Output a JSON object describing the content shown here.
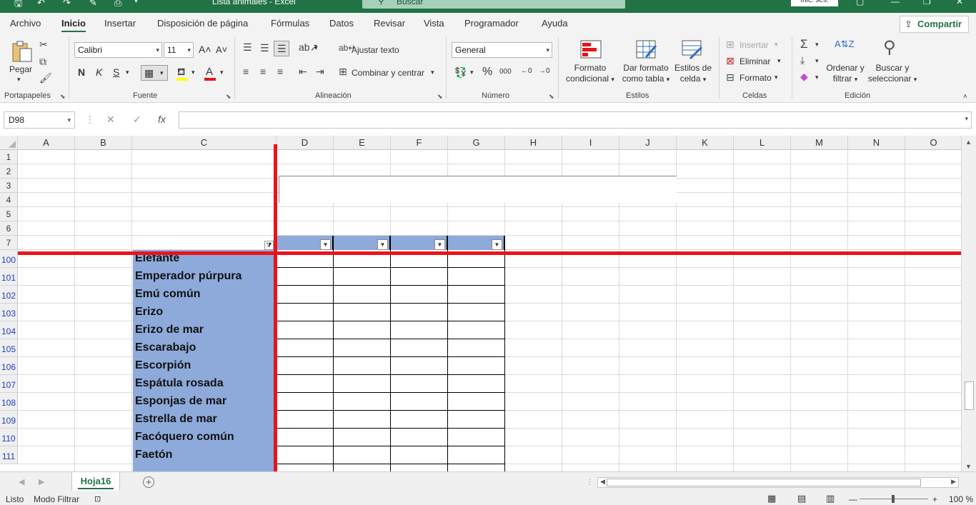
{
  "window": {
    "title": "Lista animales  -  Excel",
    "search_placeholder": "Buscar",
    "signin": "Inic. ses.",
    "share": "Compartir"
  },
  "menu": [
    "Archivo",
    "Inicio",
    "Insertar",
    "Disposición de página",
    "Fórmulas",
    "Datos",
    "Revisar",
    "Vista",
    "Programador",
    "Ayuda"
  ],
  "active_menu": "Inicio",
  "ribbon": {
    "groups": {
      "clipboard": "Portapapeles",
      "font": "Fuente",
      "alignment": "Alineación",
      "number": "Número",
      "styles": "Estilos",
      "cells": "Celdas",
      "editing": "Edición"
    },
    "paste": "Pegar",
    "font_name": "Calibri",
    "font_size": "11",
    "bold": "N",
    "italic": "K",
    "underline": "S",
    "wrap_text": "Ajustar texto",
    "merge_center": "Combinar y centrar",
    "number_format": "General",
    "conditional_format": [
      "Formato",
      "condicional"
    ],
    "format_table": [
      "Dar formato",
      "como tabla"
    ],
    "cell_styles": [
      "Estilos de",
      "celda"
    ],
    "insert": "Insertar",
    "delete": "Eliminar",
    "format": "Formato",
    "sort_filter": [
      "Ordenar y",
      "filtrar"
    ],
    "find_select": [
      "Buscar y",
      "seleccionar"
    ]
  },
  "formula_bar": {
    "name_box": "D98",
    "cancel": "✕",
    "enter": "✓",
    "fx": "fx",
    "value": ""
  },
  "columns": [
    "A",
    "B",
    "C",
    "D",
    "E",
    "F",
    "G",
    "H",
    "I",
    "J",
    "K",
    "L",
    "M",
    "N",
    "O"
  ],
  "rows_top": [
    "1",
    "2",
    "3",
    "4",
    "5",
    "6",
    "7"
  ],
  "rows_data": [
    "100",
    "101",
    "102",
    "103",
    "104",
    "105",
    "106",
    "107",
    "108",
    "109",
    "110",
    "111"
  ],
  "animals": [
    "Elefante",
    "Emperador púrpura",
    "Emú común",
    "Erizo",
    "Erizo de mar",
    "Escarabajo",
    "Escorpión",
    "Espátula rosada",
    "Esponjas de mar",
    "Estrella de mar",
    "Facóquero común",
    "Faetón"
  ],
  "sheet_tab": "Hoja16",
  "status": {
    "ready": "Listo",
    "mode": "Modo Filtrar",
    "zoom": "100 %"
  },
  "colors": {
    "brand": "#217346",
    "header_fill": "#8eaadb",
    "annotation": "#e8141c"
  }
}
